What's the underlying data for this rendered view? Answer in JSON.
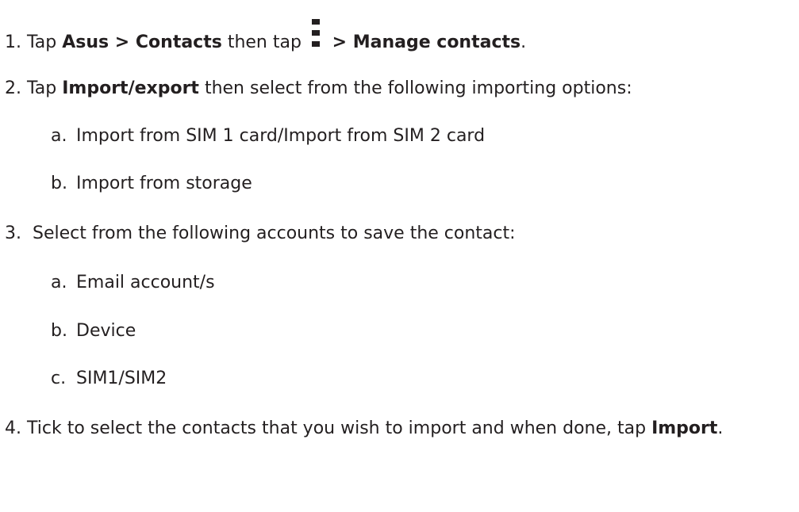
{
  "steps": [
    {
      "num": "1.",
      "pre": " Tap ",
      "b1": "Asus",
      "sep1": " > ",
      "b2": "Contacts",
      "mid": " then tap ",
      "icon": "more-options-icon",
      "sep2": " > ",
      "b3": "Manage contacts",
      "end": "."
    },
    {
      "num": "2.",
      "pre": " Tap ",
      "b1": "Import/export",
      "rest": " then select from the following importing options:"
    },
    {
      "num": "3.",
      "text": "  Select from the following accounts to save the contact:"
    },
    {
      "num": "4.",
      "pre": " Tick to select the contacts that you wish to import and when done, tap ",
      "b1": "Import",
      "end": "."
    }
  ],
  "substeps_2": [
    {
      "letter": "a.",
      "text": "Import from SIM 1 card/Import from SIM 2 card"
    },
    {
      "letter": "b.",
      "text": "Import from storage"
    }
  ],
  "substeps_3": [
    {
      "letter": "a.",
      "text": "Email account/s"
    },
    {
      "letter": "b.",
      "text": "Device"
    },
    {
      "letter": "c.",
      "text": "SIM1/SIM2"
    }
  ]
}
